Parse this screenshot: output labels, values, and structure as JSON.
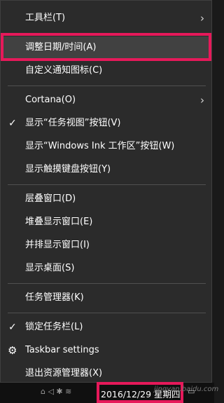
{
  "menu": {
    "items": [
      {
        "label": "工具栏(T)",
        "submenu": true
      },
      {
        "label": "调整日期/时间(A)"
      },
      {
        "label": "自定义通知图标(C)"
      },
      {
        "label": "Cortana(O)",
        "submenu": true
      },
      {
        "label": "显示“任务视图”按钮(V)",
        "checked": true
      },
      {
        "label": "显示“Windows Ink 工作区”按钮(W)"
      },
      {
        "label": "显示触摸键盘按钮(Y)"
      },
      {
        "label": "层叠窗口(D)"
      },
      {
        "label": "堆叠显示窗口(E)"
      },
      {
        "label": "并排显示窗口(I)"
      },
      {
        "label": "显示桌面(S)"
      },
      {
        "label": "任务管理器(K)"
      },
      {
        "label": "锁定任务栏(L)",
        "checked": true
      },
      {
        "label": "Taskbar settings",
        "icon": "gear-icon"
      },
      {
        "label": "退出资源管理器(X)"
      }
    ]
  },
  "taskbar": {
    "date_text": "2016/12/29 星期四",
    "watermark": "jingyan.baidu.com"
  },
  "colors": {
    "menu_bg": "#2b2b2b",
    "highlight_border": "#e6195a",
    "text": "#ffffff"
  }
}
